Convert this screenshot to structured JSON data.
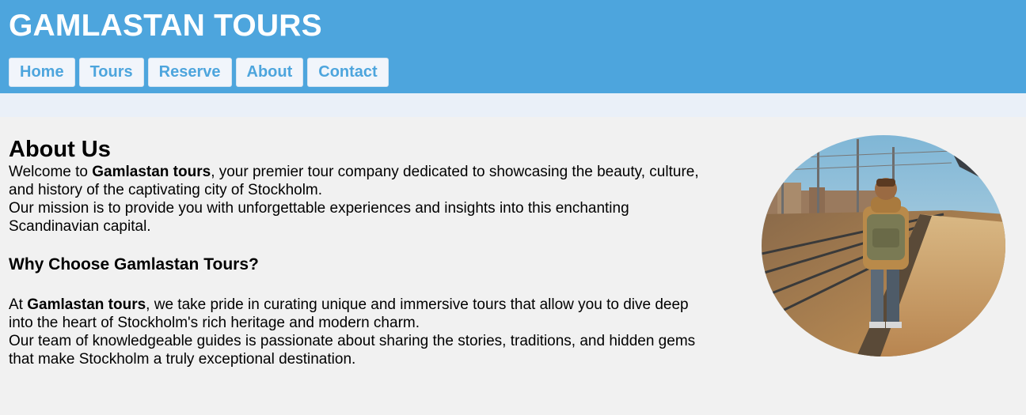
{
  "site": {
    "title": "GAMLASTAN TOURS"
  },
  "nav": {
    "items": [
      {
        "label": "Home"
      },
      {
        "label": "Tours"
      },
      {
        "label": "Reserve"
      },
      {
        "label": "About"
      },
      {
        "label": "Contact"
      }
    ]
  },
  "about": {
    "heading": "About Us",
    "intro_prefix": "Welcome to ",
    "intro_brand": "Gamlastan tours",
    "intro_suffix": ", your premier tour company dedicated to showcasing the beauty, culture, and history of the captivating city of Stockholm.",
    "mission": "Our mission is to provide you with unforgettable experiences and insights into this enchanting Scandinavian capital.",
    "why_heading": "Why Choose Gamlastan Tours?",
    "why_prefix": "At ",
    "why_brand": "Gamlastan tours",
    "why_suffix": ", we take pride in curating unique and immersive tours that allow you to dive deep into the heart of Stockholm's rich heritage and modern charm.",
    "team": "Our team of knowledgeable guides is passionate about sharing the stories, traditions, and hidden gems that make Stockholm a truly exceptional destination."
  },
  "colors": {
    "header_bg": "#4da5dd",
    "nav_text": "#4da5dd",
    "page_bg": "#f1f1f1"
  }
}
